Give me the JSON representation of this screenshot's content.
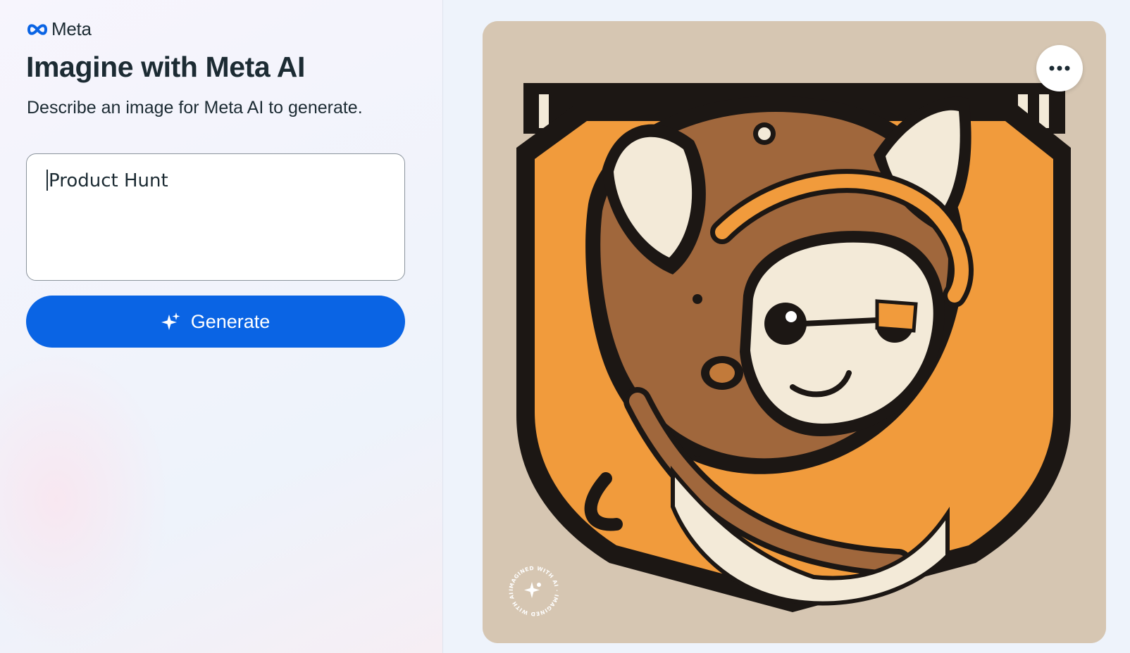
{
  "brand": {
    "name": "Meta",
    "icon": "meta-infinity-logo-icon"
  },
  "header": {
    "title": "Imagine with Meta AI",
    "subtitle": "Describe an image for Meta AI to generate."
  },
  "prompt": {
    "value": "Product Hunt"
  },
  "generate_button": {
    "label": "Generate",
    "icon": "sparkle-icon"
  },
  "result": {
    "image_description": "Illustrated cat wearing an orange aviator helmet on a shield emblem",
    "more_button_icon": "more-horizontal-icon",
    "watermark_text": "IMAGINED WITH AI · IMAGINED WITH AI ·"
  },
  "colors": {
    "accent": "#0a64e4",
    "text": "#1c2b33",
    "image_bg": "#d6c6b2",
    "shield_orange": "#f19b3c",
    "helmet_brown": "#a0673c"
  }
}
